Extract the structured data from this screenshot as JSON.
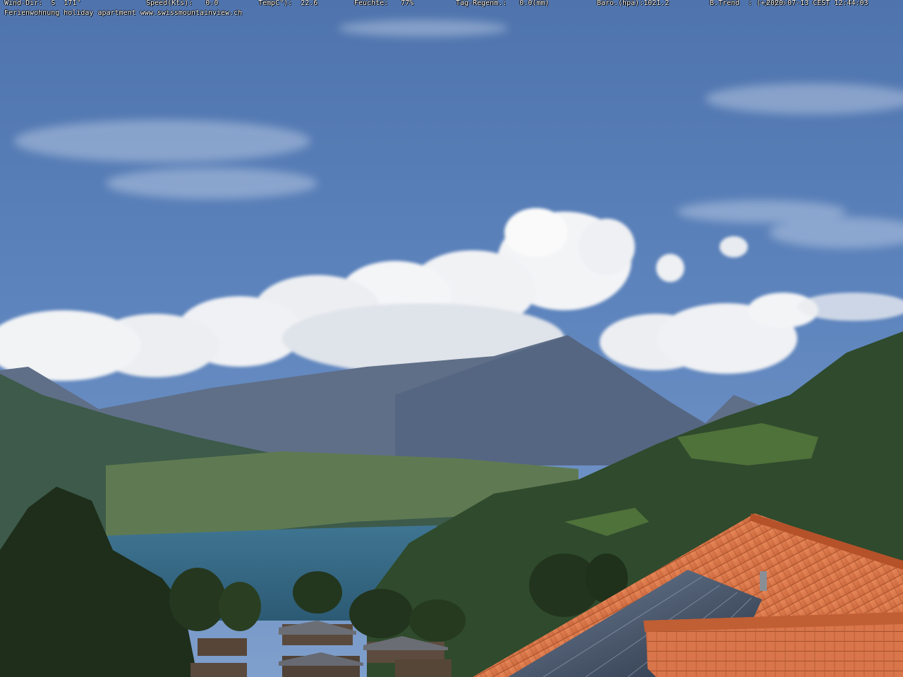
{
  "overlay": {
    "wind_dir": "Wind-Dir:  S  171°",
    "speed": "Speed(Kts):   0.0",
    "temp": "TempC°):  22.6",
    "humidity": "Feuchte:   77%",
    "rain": "Tag-Regenm.:   0.0(mm)",
    "baro": "Baro.(hpa):1021.2",
    "trend": "B.Trend  : (+/-) :",
    "timestamp": "2020-07-13 CEST 12:44:03",
    "caption": "Ferienwohnung holiday apartment www.swissmountainview.ch"
  }
}
